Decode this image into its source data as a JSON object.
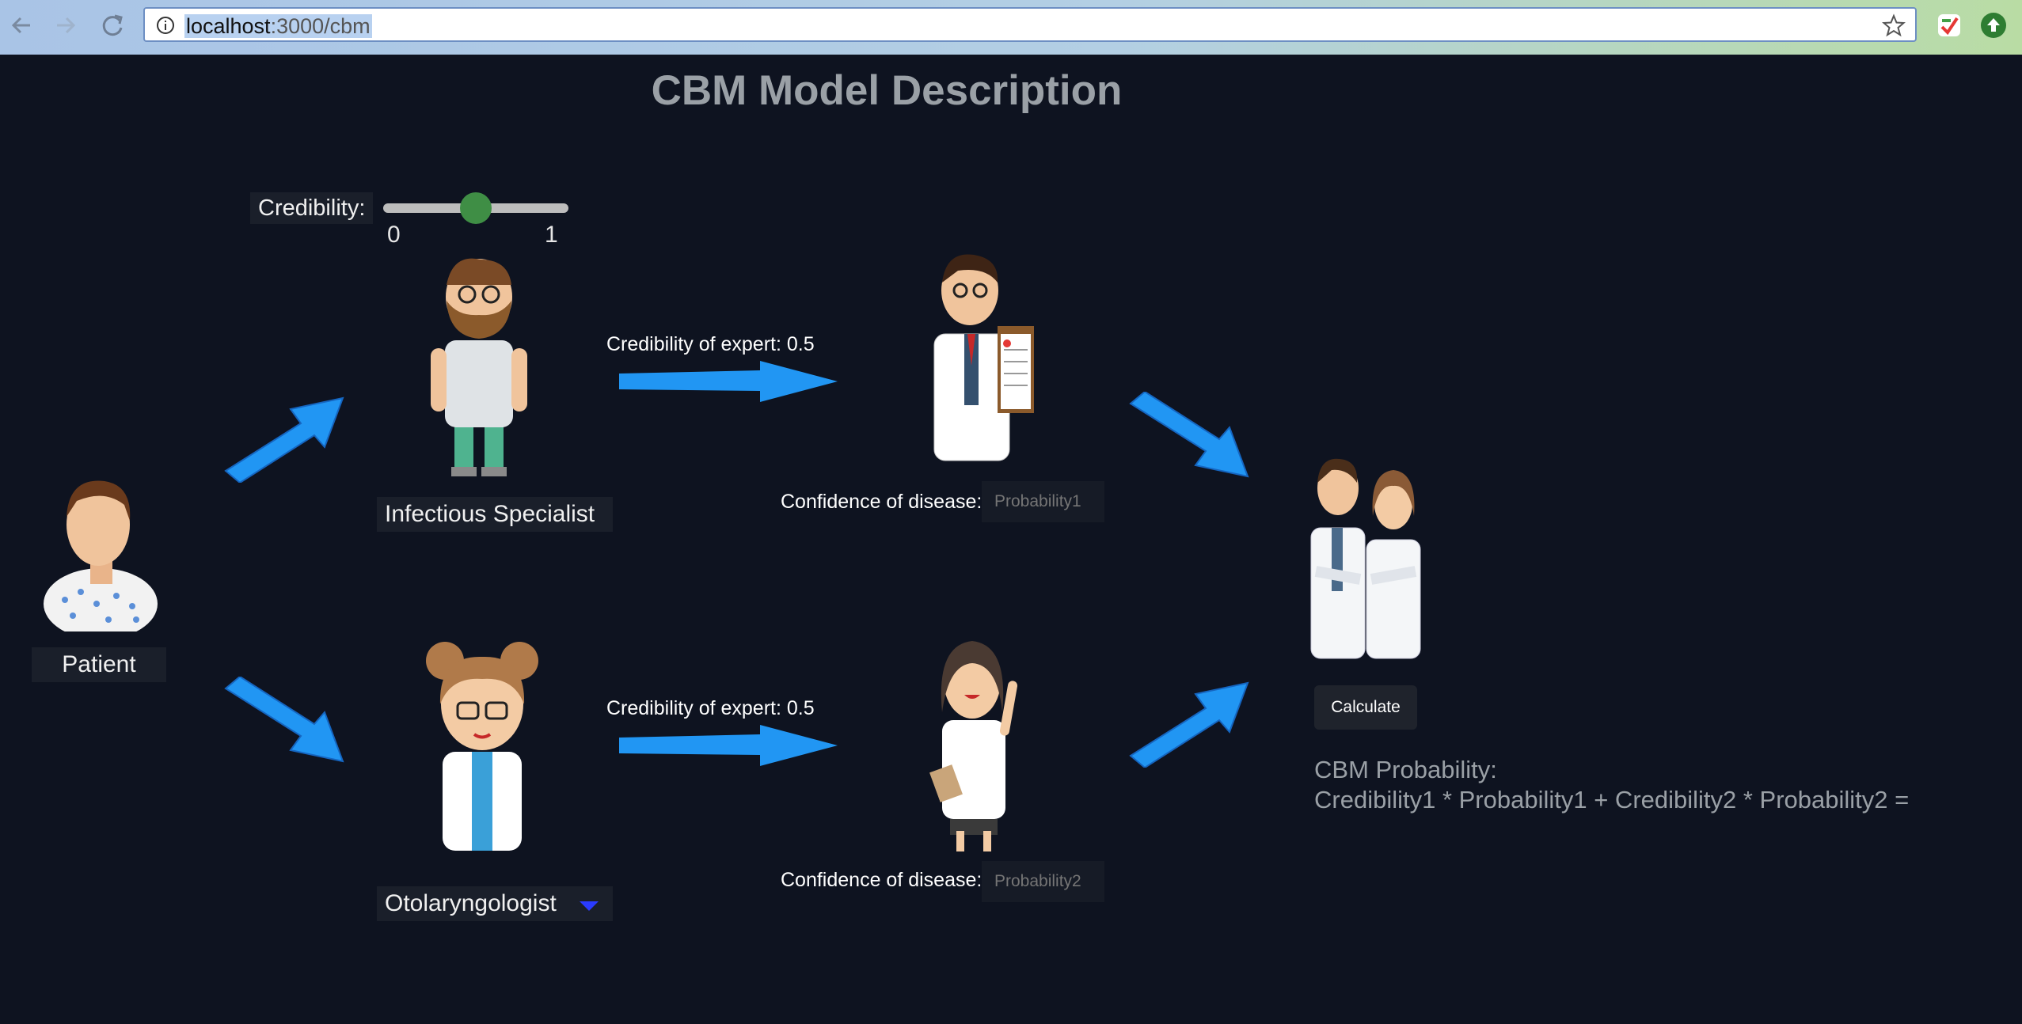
{
  "browser": {
    "url_host": "localhost",
    "url_path": ":3000/cbm"
  },
  "page": {
    "title": "CBM Model Description"
  },
  "patient": {
    "label": "Patient"
  },
  "credibility_slider": {
    "label": "Credibility:",
    "min_label": "0",
    "max_label": "1",
    "value": 0.5
  },
  "expert1": {
    "name": "Infectious Specialist",
    "credibility_text": "Credibility of expert: 0.5",
    "confidence_label": "Confidence of disease:",
    "probability_placeholder": "Probability1"
  },
  "expert2": {
    "name": "Otolaryngologist",
    "credibility_text": "Credibility of expert: 0.5",
    "confidence_label": "Confidence of disease:",
    "probability_placeholder": "Probability2"
  },
  "calculate": {
    "label": "Calculate"
  },
  "result": {
    "heading": "CBM Probability:",
    "formula": "Credibility1 * Probability1 + Credibility2 * Probability2 ="
  },
  "colors": {
    "background": "#0e1320",
    "arrow": "#2196f3",
    "slider_thumb": "#3f8e45",
    "title": "#9aa0a6"
  }
}
